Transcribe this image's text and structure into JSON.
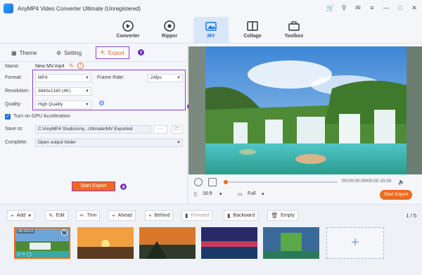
{
  "window": {
    "title": "AnyMP4 Video Converter Ultimate (Unregistered)",
    "controls": [
      "cart-icon",
      "user-icon",
      "chat-icon",
      "menu-icon",
      "minimize-icon",
      "maximize-icon",
      "close-icon"
    ]
  },
  "nav": {
    "items": [
      {
        "label": "Converter",
        "icon": "converter-icon"
      },
      {
        "label": "Ripper",
        "icon": "ripper-icon"
      },
      {
        "label": "MV",
        "icon": "mv-icon",
        "active": true
      },
      {
        "label": "Collage",
        "icon": "collage-icon"
      },
      {
        "label": "Toolbox",
        "icon": "toolbox-icon"
      }
    ]
  },
  "tabs": {
    "theme": "Theme",
    "setting": "Setting",
    "export": "Export",
    "export_badge": "7"
  },
  "export": {
    "name_label": "Name:",
    "name_value": "New MV.mp4",
    "format_label": "Format:",
    "format_value": "MP4",
    "frame_rate_label": "Frame Rate:",
    "frame_rate_value": "24fps",
    "resolution_label": "Resolution:",
    "resolution_value": "3840x2160 (4K)",
    "quality_label": "Quality:",
    "quality_value": "High Quality",
    "gpu_label": "Turn on GPU Acceleration",
    "gpu_checked": true,
    "save_to_label": "Save to:",
    "save_to_value": "C:\\AnyMP4 Studio\\Any...Ultimate\\MV Exported",
    "browse_label": "···",
    "complete_label": "Complete:",
    "complete_value": "Open output folder",
    "badge_settings": "8",
    "start_export": "Start Export",
    "badge_start": "9"
  },
  "player": {
    "timecode": "00:00:00.00/00:00:10.00",
    "aspect": "16:9",
    "view": "Full",
    "start_export": "Start Export"
  },
  "toolbar": {
    "add": "Add",
    "edit": "Edit",
    "trim": "Trim",
    "ahead": "Ahead",
    "behind": "Behind",
    "forward": "Forward",
    "backward": "Backward",
    "empty": "Empty",
    "page": "1",
    "total": "/ 5"
  },
  "clips": [
    {
      "time": "00:00:02",
      "selected": true
    },
    {
      "time": "",
      "selected": false
    },
    {
      "time": "",
      "selected": false
    },
    {
      "time": "",
      "selected": false
    },
    {
      "time": "",
      "selected": false
    }
  ],
  "colors": {
    "accent": "#f06a1c",
    "highlight": "#8b3fd4",
    "active_nav": "#1b74e8"
  }
}
